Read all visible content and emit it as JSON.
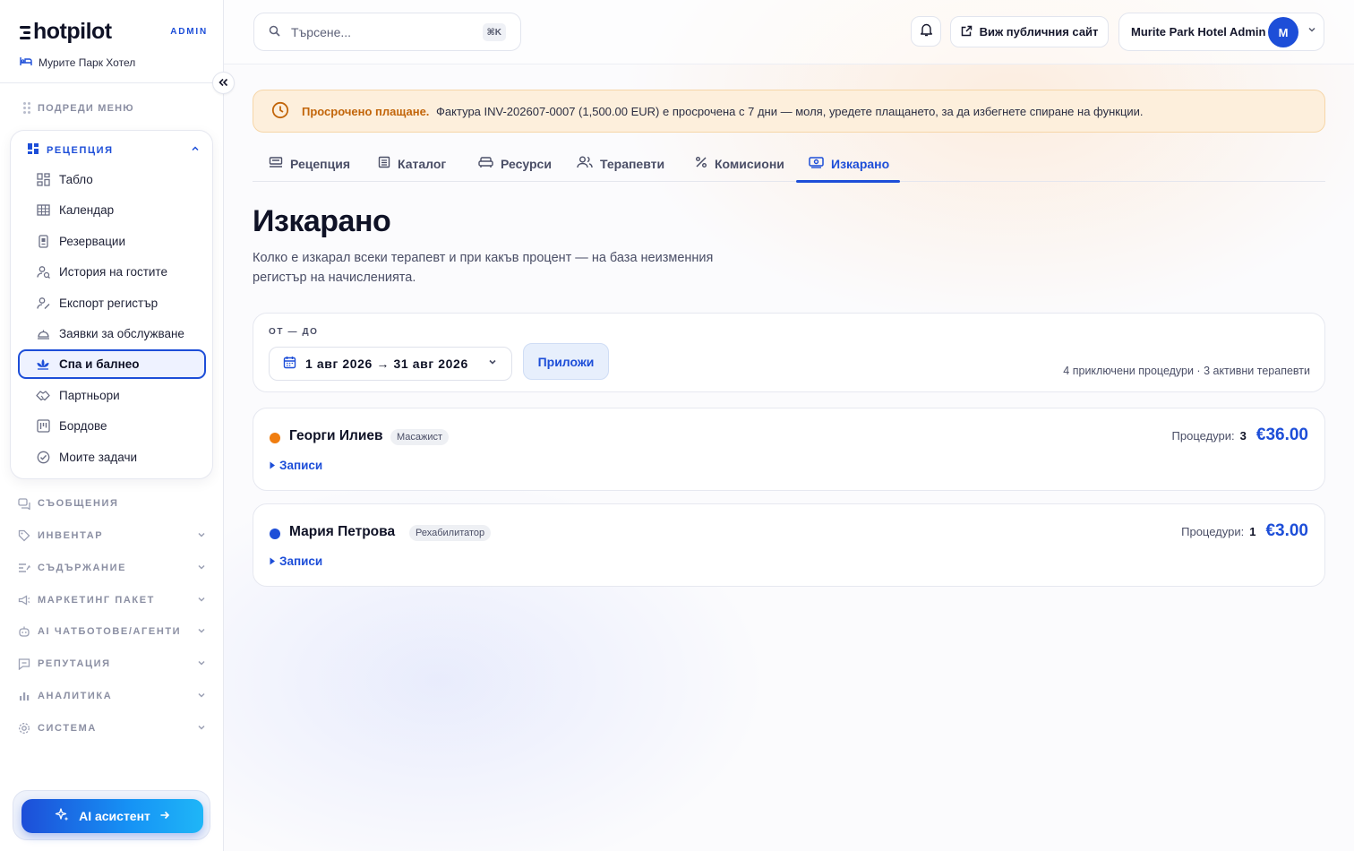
{
  "brand": {
    "logo_text": "hotpilot",
    "admin_label": "ADMIN",
    "hotel_name": "Мурите Парк Хотел"
  },
  "sidebar": {
    "reorder_label": "ПОДРЕДИ МЕНЮ",
    "group": {
      "title": "РЕЦЕПЦИЯ",
      "items": [
        {
          "label": "Табло",
          "icon": "dashboard-icon"
        },
        {
          "label": "Календар",
          "icon": "calendar-grid-icon"
        },
        {
          "label": "Резервации",
          "icon": "reservations-icon"
        },
        {
          "label": "История на гостите",
          "icon": "guest-history-icon"
        },
        {
          "label": "Експорт регистър",
          "icon": "export-register-icon"
        },
        {
          "label": "Заявки за обслужване",
          "icon": "service-bell-icon"
        },
        {
          "label": "Спа и балнео",
          "icon": "spa-lotus-icon",
          "active": true
        },
        {
          "label": "Партньори",
          "icon": "handshake-icon"
        },
        {
          "label": "Бордове",
          "icon": "board-icon"
        },
        {
          "label": "Моите задачи",
          "icon": "check-circle-icon"
        }
      ]
    },
    "sections": [
      {
        "label": "СЪОБЩЕНИЯ",
        "icon": "messages-icon",
        "chevron": false
      },
      {
        "label": "ИНВЕНТАР",
        "icon": "tag-icon",
        "chevron": true
      },
      {
        "label": "СЪДЪРЖАНИЕ",
        "icon": "content-icon",
        "chevron": true
      },
      {
        "label": "МАРКЕТИНГ ПАКЕТ",
        "icon": "megaphone-icon",
        "chevron": true
      },
      {
        "label": "AI ЧАТБОТОВЕ/АГЕНТИ",
        "icon": "bot-icon",
        "chevron": true
      },
      {
        "label": "РЕПУТАЦИЯ",
        "icon": "review-icon",
        "chevron": true
      },
      {
        "label": "АНАЛИТИКА",
        "icon": "bar-chart-icon",
        "chevron": true
      },
      {
        "label": "СИСТЕМА",
        "icon": "gear-icon",
        "chevron": true
      }
    ],
    "ai_button": "AI асистент"
  },
  "topbar": {
    "search_placeholder": "Търсене...",
    "search_shortcut": "⌘K",
    "public_site_label": "Виж публичния сайт",
    "user_name": "Murite Park Hotel Admin",
    "avatar_initial": "M"
  },
  "alert": {
    "title": "Просрочено плащане.",
    "message": "Фактура INV-202607-0007 (1,500.00 EUR) е просрочена с 7 дни — моля, уредете плащането, за да избегнете спиране на функции."
  },
  "tabs": [
    {
      "label": "Рецепция",
      "icon": "reception-icon"
    },
    {
      "label": "Каталог",
      "icon": "catalog-icon"
    },
    {
      "label": "Ресурси",
      "icon": "sofa-icon"
    },
    {
      "label": "Терапевти",
      "icon": "users-icon"
    },
    {
      "label": "Комисиони",
      "icon": "percent-icon"
    },
    {
      "label": "Изкарано",
      "icon": "money-icon",
      "active": true
    }
  ],
  "page": {
    "title": "Изкарано",
    "subtitle": "Колко е изкарал всеки терапевт и при какъв процент — на база неизменния регистър на начисленията."
  },
  "filter": {
    "range_label": "ОТ — ДО",
    "date_range": "1 авг 2026 → 31 авг 2026",
    "apply_label": "Приложи",
    "summary": "4 приключени процедури · 3 активни терапевти"
  },
  "therapists": [
    {
      "name": "Георги Илиев",
      "role": "Масажист",
      "dot_color": "#f07d0f",
      "count_label": "Процедури:",
      "count": "3",
      "amount": "€36.00",
      "records_label": "Записи"
    },
    {
      "name": "Мария Петрова",
      "role": "Рехабилитатор",
      "dot_color": "#1d4ed8",
      "count_label": "Процедури:",
      "count": "1",
      "amount": "€3.00",
      "records_label": "Записи"
    }
  ],
  "colors": {
    "accent": "#1d4ed8",
    "warning": "#c2650a"
  }
}
